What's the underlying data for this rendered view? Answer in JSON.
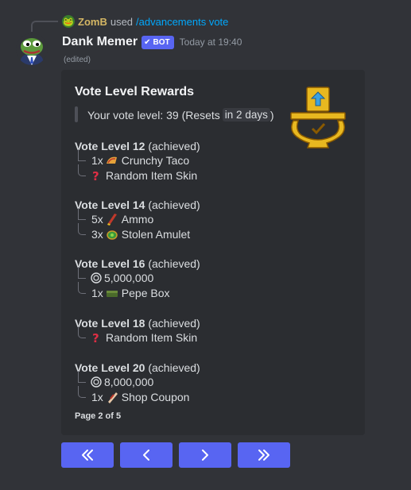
{
  "reply": {
    "username": "ZomB",
    "used_text": "used",
    "command": "/advancements vote"
  },
  "message": {
    "username": "Dank Memer",
    "bot_tag": "BOT",
    "timestamp": "Today at 19:40",
    "edited": "(edited)"
  },
  "embed": {
    "title": "Vote Level Rewards",
    "vote_level_text": "Your vote level: 39 (Resets",
    "resets_in": "in 2 days",
    "close_paren": ")",
    "levels": [
      {
        "name": "Vote Level 12",
        "status": "(achieved)",
        "items": [
          {
            "qty": "1x",
            "icon": "taco-icon",
            "label": "Crunchy Taco"
          },
          {
            "qty": "",
            "icon": "question-mark-icon",
            "label": "Random Item Skin"
          }
        ]
      },
      {
        "name": "Vote Level 14",
        "status": "(achieved)",
        "items": [
          {
            "qty": "5x",
            "icon": "ammo-icon",
            "label": "Ammo"
          },
          {
            "qty": "3x",
            "icon": "amulet-icon",
            "label": "Stolen Amulet"
          }
        ]
      },
      {
        "name": "Vote Level 16",
        "status": "(achieved)",
        "items": [
          {
            "qty": "",
            "icon": "coin-icon",
            "label": "5,000,000"
          },
          {
            "qty": "1x",
            "icon": "box-icon",
            "label": "Pepe Box"
          }
        ]
      },
      {
        "name": "Vote Level 18",
        "status": "(achieved)",
        "items": [
          {
            "qty": "",
            "icon": "question-mark-icon",
            "label": "Random Item Skin"
          }
        ]
      },
      {
        "name": "Vote Level 20",
        "status": "(achieved)",
        "items": [
          {
            "qty": "",
            "icon": "coin-icon",
            "label": "8,000,000"
          },
          {
            "qty": "1x",
            "icon": "coupon-icon",
            "label": "Shop Coupon"
          }
        ]
      }
    ],
    "footer": "Page 2 of 5"
  },
  "buttons": [
    {
      "icon": "double-chevron-left-icon"
    },
    {
      "icon": "chevron-left-icon"
    },
    {
      "icon": "chevron-right-icon"
    },
    {
      "icon": "double-chevron-right-icon"
    }
  ],
  "colors": {
    "background": "#313338",
    "embed": "#2b2d31",
    "blurple": "#5865f2",
    "command_link": "#00a8fc",
    "reply_user": "#d4b664"
  }
}
